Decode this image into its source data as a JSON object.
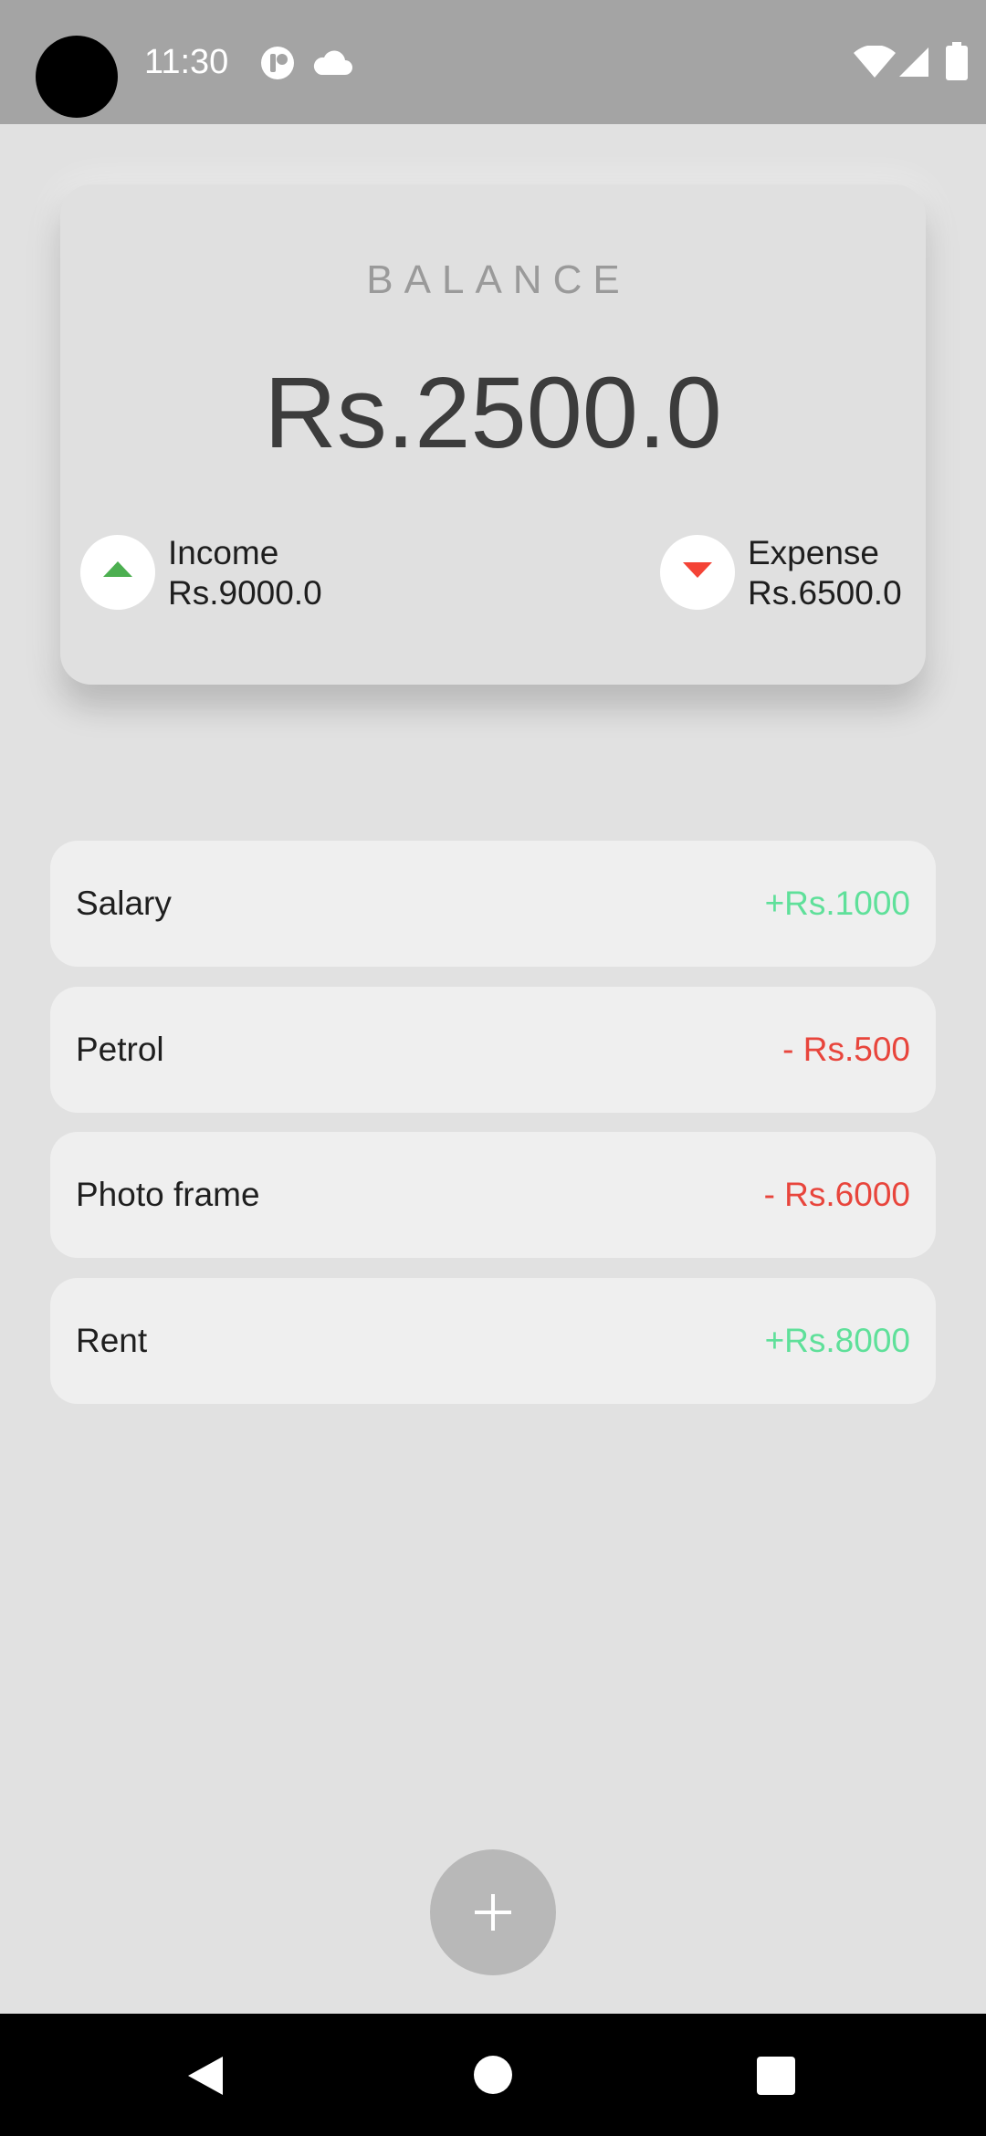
{
  "status_bar": {
    "time": "11:30",
    "icons": [
      "notification-app-icon",
      "cloud-icon",
      "wifi-icon",
      "signal-icon",
      "battery-icon"
    ]
  },
  "balance": {
    "label": "BALANCE",
    "amount": "Rs.2500.0",
    "income_label": "Income",
    "income_amount": "Rs.9000.0",
    "expense_label": "Expense",
    "expense_amount": "Rs.6500.0"
  },
  "transactions": [
    {
      "name": "Salary",
      "amount": "+Rs.1000",
      "type": "income"
    },
    {
      "name": "Petrol",
      "amount": "- Rs.500",
      "type": "expense"
    },
    {
      "name": "Photo frame",
      "amount": "- Rs.6000",
      "type": "expense"
    },
    {
      "name": "Rent",
      "amount": "+Rs.8000",
      "type": "income"
    }
  ],
  "colors": {
    "income": "#5fe09a",
    "expense": "#e8453c",
    "income_arrow": "#4caf50",
    "expense_arrow": "#f44336"
  },
  "fab": {
    "icon": "plus-icon"
  },
  "nav_bar": {
    "icons": [
      "back-icon",
      "home-icon",
      "recents-icon"
    ]
  }
}
